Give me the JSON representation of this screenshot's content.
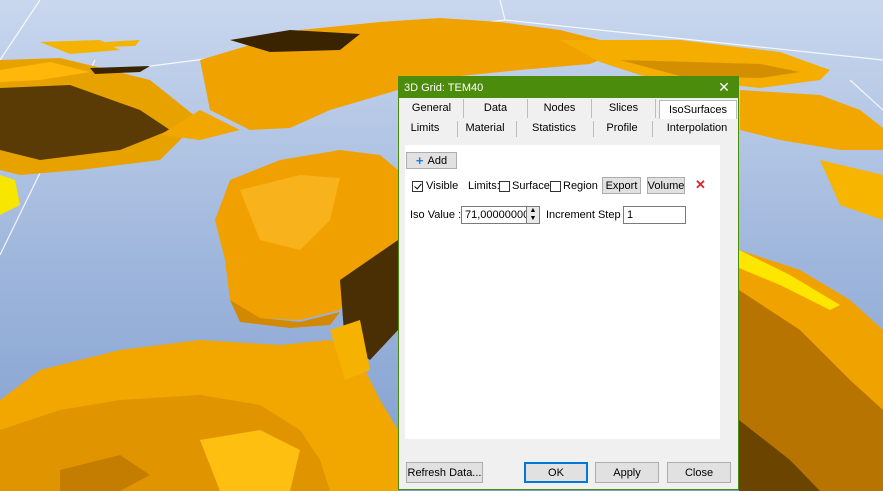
{
  "dialog": {
    "title": "3D Grid: TEM40",
    "tabs_row1": [
      "General",
      "Data",
      "Nodes",
      "Slices",
      "IsoSurfaces"
    ],
    "tabs_row2": [
      "Limits",
      "Material",
      "Statistics",
      "Profile",
      "Interpolation"
    ],
    "active_tab": "IsoSurfaces"
  },
  "iso": {
    "add_label": "Add",
    "visible_label": "Visible",
    "visible_checked": true,
    "limits_label": "Limits:",
    "surface_label": "Surface",
    "surface_checked": false,
    "region_label": "Region",
    "region_checked": false,
    "export_label": "Export",
    "volume_label": "Volume",
    "delete_symbol": "✕",
    "iso_value_label": "Iso Value :",
    "iso_value": "71,000000000",
    "increment_label": "Increment Step :",
    "increment_value": "1"
  },
  "footer": {
    "refresh_label": "Refresh Data...",
    "ok_label": "OK",
    "apply_label": "Apply",
    "close_label": "Close"
  },
  "colors": {
    "title_bar": "#4c8c0c",
    "sky": "#8aa7d2",
    "surface_orange": "#f2a600",
    "surface_dark": "#5a3a00"
  }
}
